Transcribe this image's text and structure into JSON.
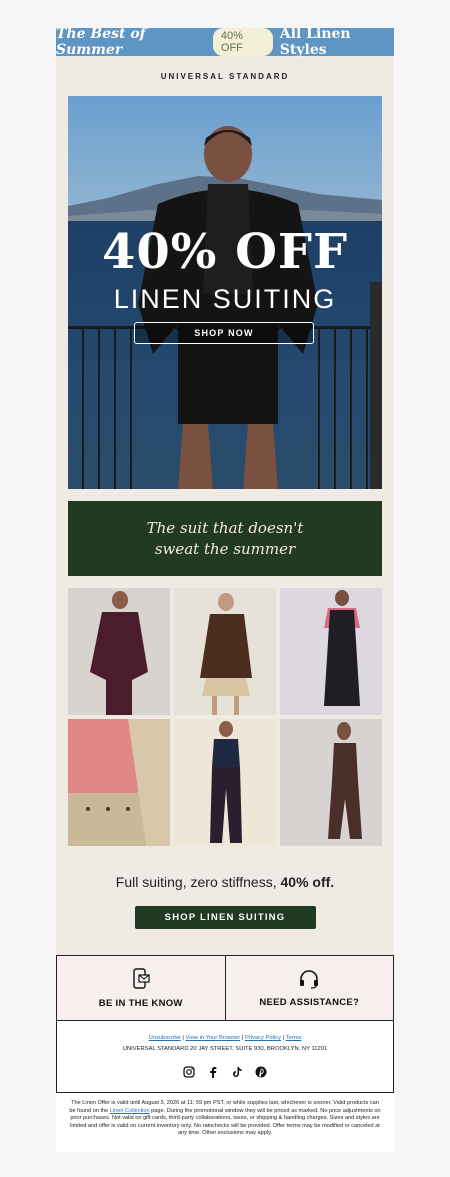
{
  "banner": {
    "left": "The Best of Summer",
    "pill": "40% OFF",
    "right": "All Linen Styles"
  },
  "brand": "UNIVERSAL STANDARD",
  "hero": {
    "headline": "40% OFF",
    "subheadline": "LINEN SUITING",
    "button": "SHOP NOW"
  },
  "quote": {
    "line1": "The suit that doesn't",
    "line2": "sweat the summer"
  },
  "tiles": [
    {
      "bg": "#d9d3cf",
      "outfit": "#4a1c2e"
    },
    {
      "bg": "#e6e2d8",
      "outfit": "#4a2d1e"
    },
    {
      "bg": "#ddd8e0",
      "outfit": "#1e1e24"
    },
    {
      "bg": "#e8e0d2",
      "outfit": "#c9b89a"
    },
    {
      "bg": "#efe6d8",
      "outfit": "#2a1f2e"
    },
    {
      "bg": "#d8d2d0",
      "outfit": "#4a2e2a"
    }
  ],
  "tagline": {
    "text": "Full suiting, zero stiffness, ",
    "bold": "40% off."
  },
  "cta": "SHOP LINEN SUITING",
  "footer": {
    "left_label": "BE IN THE KNOW",
    "right_label": "NEED ASSISTANCE?",
    "links": [
      "Unsubscribe",
      "View in Your Browser",
      "Privacy Policy",
      "Terms"
    ],
    "address": "UNIVERSAL STANDARD 20 JAY STREET, SUITE 930, BROOKLYN, NY 11201",
    "social": [
      "instagram-icon",
      "facebook-icon",
      "tiktok-icon",
      "pinterest-icon"
    ]
  },
  "legal": {
    "part1": "The Linen Offer is valid until August 3, 2026 at 11: 59 pm PST, or while supplies last, whichever is sooner. Valid products can be found on the ",
    "link": "Linen Collection",
    "part2": " page. During the promotional window they will be priced as marked. No price adjustments on prior purchases. Not valid on gift cards, third-party collaborations, taxes, or shipping & handling charges. Sizes and styles are limited and offer is valid on current inventory only. No rainchecks will be provided. Offer terms may be modified or canceled at any time. Other exclusions may apply."
  },
  "colors": {
    "banner_bg": "#5f95c3",
    "green": "#223a22",
    "cream": "#efebe4"
  }
}
